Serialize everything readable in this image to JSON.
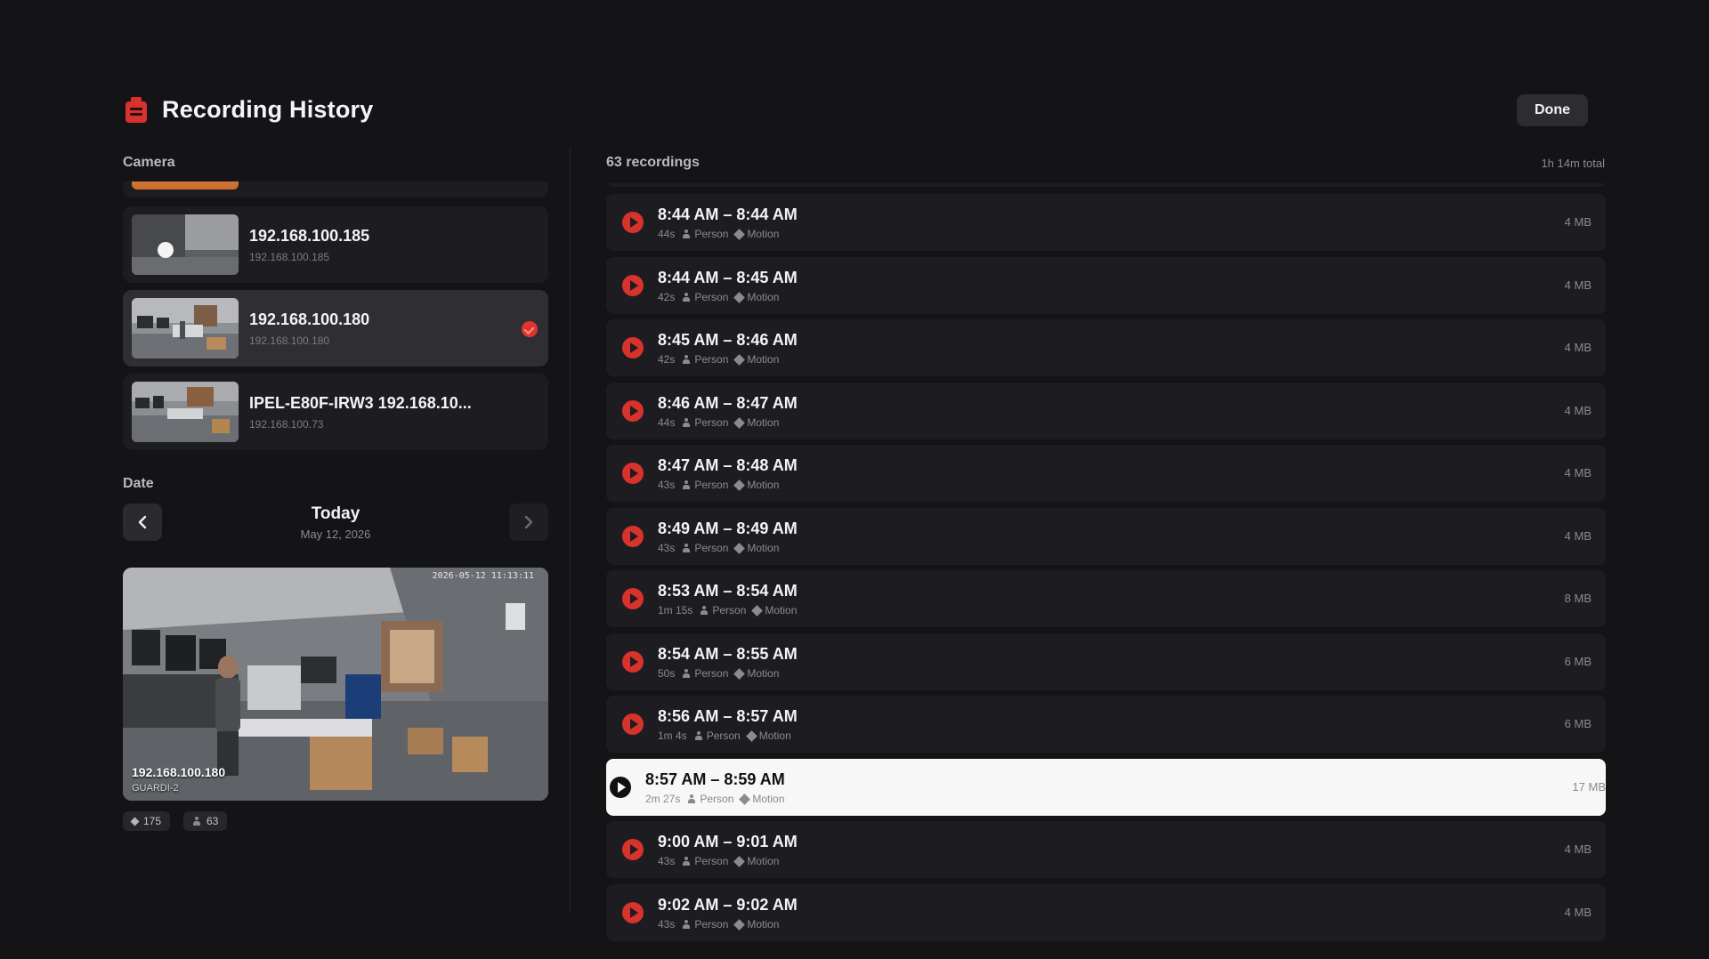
{
  "header": {
    "title": "Recording History",
    "done_label": "Done"
  },
  "camera_section": {
    "label": "Camera",
    "cameras": [
      {
        "name": "192.168.100.185",
        "ip": "192.168.100.185",
        "selected": false
      },
      {
        "name": "192.168.100.180",
        "ip": "192.168.100.180",
        "selected": true
      },
      {
        "name": "IPEL-E80F-IRW3 192.168.10...",
        "ip": "192.168.100.73",
        "selected": false
      }
    ]
  },
  "date_section": {
    "label": "Date",
    "title": "Today",
    "date": "May 12, 2026"
  },
  "preview": {
    "camera_name": "192.168.100.180",
    "camera_sub": "GUARDI-2",
    "timestamp": "2026-05-12 11:13:11"
  },
  "stats": {
    "motion_count": "175",
    "person_count": "63"
  },
  "recordings_header": {
    "count_label": "63 recordings",
    "total_label": "1h 14m total"
  },
  "recordings": [
    {
      "time": "8:44 AM – 8:44 AM",
      "duration": "44s",
      "tag1": "Person",
      "tag2": "Motion",
      "size": "4 MB"
    },
    {
      "time": "8:44 AM – 8:45 AM",
      "duration": "42s",
      "tag1": "Person",
      "tag2": "Motion",
      "size": "4 MB"
    },
    {
      "time": "8:45 AM – 8:46 AM",
      "duration": "42s",
      "tag1": "Person",
      "tag2": "Motion",
      "size": "4 MB"
    },
    {
      "time": "8:46 AM – 8:47 AM",
      "duration": "44s",
      "tag1": "Person",
      "tag2": "Motion",
      "size": "4 MB"
    },
    {
      "time": "8:47 AM – 8:48 AM",
      "duration": "43s",
      "tag1": "Person",
      "tag2": "Motion",
      "size": "4 MB"
    },
    {
      "time": "8:49 AM – 8:49 AM",
      "duration": "43s",
      "tag1": "Person",
      "tag2": "Motion",
      "size": "4 MB"
    },
    {
      "time": "8:53 AM – 8:54 AM",
      "duration": "1m 15s",
      "tag1": "Person",
      "tag2": "Motion",
      "size": "8 MB"
    },
    {
      "time": "8:54 AM – 8:55 AM",
      "duration": "50s",
      "tag1": "Person",
      "tag2": "Motion",
      "size": "6 MB"
    },
    {
      "time": "8:56 AM – 8:57 AM",
      "duration": "1m 4s",
      "tag1": "Person",
      "tag2": "Motion",
      "size": "6 MB"
    },
    {
      "time": "8:57 AM – 8:59 AM",
      "duration": "2m 27s",
      "tag1": "Person",
      "tag2": "Motion",
      "size": "17 MB",
      "active": true
    },
    {
      "time": "9:00 AM – 9:01 AM",
      "duration": "43s",
      "tag1": "Person",
      "tag2": "Motion",
      "size": "4 MB"
    },
    {
      "time": "9:02 AM – 9:02 AM",
      "duration": "43s",
      "tag1": "Person",
      "tag2": "Motion",
      "size": "4 MB"
    }
  ],
  "colors": {
    "accent_red": "#d8322c",
    "background": "#141417",
    "card": "#1d1d21",
    "active_row": "#f7f7f8"
  }
}
